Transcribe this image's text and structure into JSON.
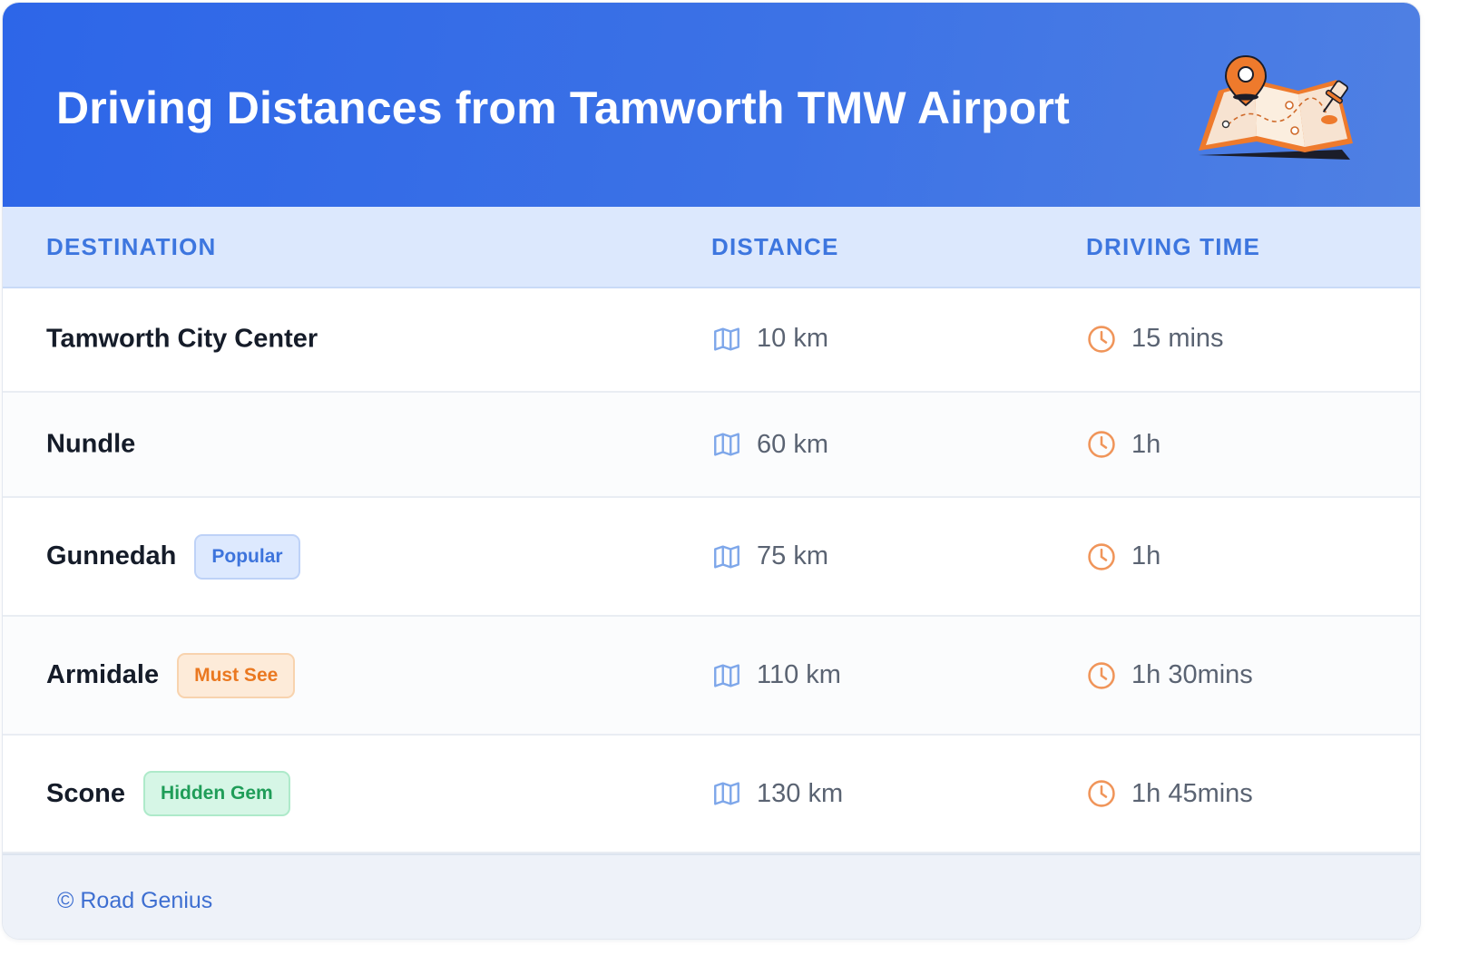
{
  "header": {
    "title": "Driving Distances from Tamworth TMW Airport",
    "illustration_icon": "map-with-location-pin-icon"
  },
  "columns": {
    "destination": "DESTINATION",
    "distance": "DISTANCE",
    "driving_time": "DRIVING TIME"
  },
  "rows": [
    {
      "destination": "Tamworth City Center",
      "badge": "",
      "badge_type": "",
      "distance": "10 km",
      "time": "15 mins"
    },
    {
      "destination": "Nundle",
      "badge": "",
      "badge_type": "",
      "distance": "60 km",
      "time": "1h"
    },
    {
      "destination": "Gunnedah",
      "badge": "Popular",
      "badge_type": "popular",
      "distance": "75 km",
      "time": "1h"
    },
    {
      "destination": "Armidale",
      "badge": "Must See",
      "badge_type": "mustsee",
      "distance": "110 km",
      "time": "1h 30mins"
    },
    {
      "destination": "Scone",
      "badge": "Hidden Gem",
      "badge_type": "gem",
      "distance": "130 km",
      "time": "1h 45mins"
    }
  ],
  "icons": {
    "distance": "map-icon",
    "time": "clock-icon"
  },
  "footer": {
    "copyright": "© Road Genius"
  },
  "colors": {
    "header_start": "#2d66e8",
    "header_end": "#4f80e3",
    "column_header_text": "#3d76df",
    "map_icon": "#7ea7ea",
    "clock_icon": "#f0955a",
    "popular": "#3d74dc",
    "must_see": "#ea7820",
    "hidden_gem": "#1f9d58"
  }
}
